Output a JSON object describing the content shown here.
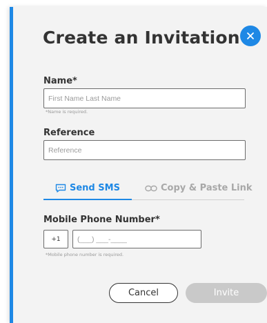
{
  "dialog": {
    "title": "Create an Invitation",
    "accent_color": "#1e88e5"
  },
  "name_field": {
    "label": "Name*",
    "placeholder": "First Name Last Name",
    "hint": "*Name is required."
  },
  "reference_field": {
    "label": "Reference",
    "placeholder": "Reference"
  },
  "tabs": [
    {
      "label": "Send SMS",
      "icon": "chat-icon",
      "active": true
    },
    {
      "label": "Copy & Paste Link",
      "icon": "link-icon",
      "active": false
    }
  ],
  "phone_field": {
    "label": "Mobile Phone Number*",
    "country_code": "+1",
    "placeholder": "(___) ___-____",
    "hint": "*Mobile phone number is required."
  },
  "actions": {
    "cancel_label": "Cancel",
    "invite_label": "Invite",
    "invite_color": "#c9c9c9"
  }
}
